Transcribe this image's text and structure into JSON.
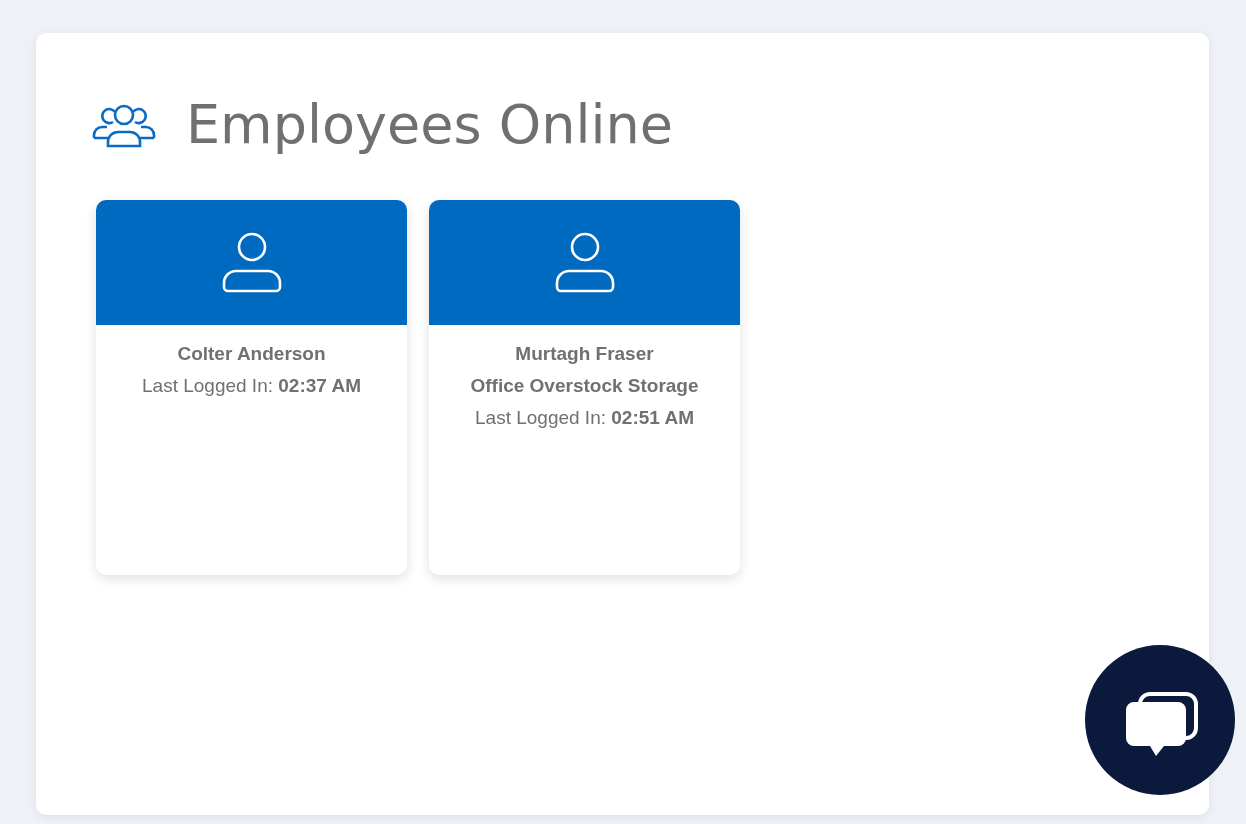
{
  "panel": {
    "title": "Employees Online"
  },
  "employees": [
    {
      "name": "Colter Anderson",
      "last_login": "Last Logged In: **02:37 AM**"
    },
    {
      "name": "Murtagh Fraser",
      "location": "Office Overstock Storage",
      "last_login": "Last Logged In: **02:51 AM**"
    }
  ]
}
